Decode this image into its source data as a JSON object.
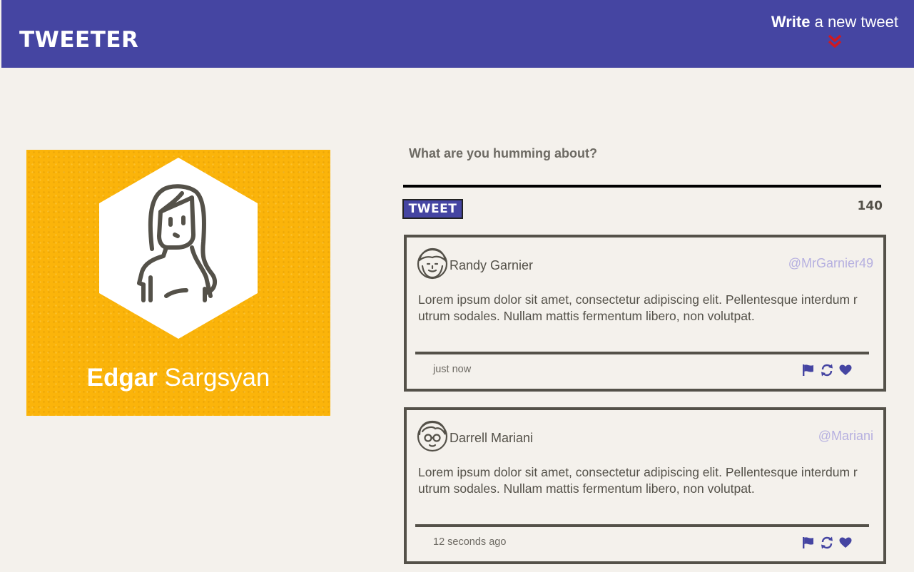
{
  "nav": {
    "brand": "TWEETER",
    "compose_bold": "Write",
    "compose_rest": "a new tweet",
    "toggle_icon": "double-chevron-down-icon",
    "accent": "#d2181f"
  },
  "profile": {
    "first_name": "Edgar",
    "last_name": "Sargsyan",
    "avatar_icon": "woman-avatar-icon"
  },
  "composer": {
    "placeholder": "What are you humming about?",
    "button_label": "TWEET",
    "counter": "140"
  },
  "tweets": [
    {
      "author": "Randy Garnier",
      "handle": "@MrGarnier49",
      "body": "Lorem ipsum dolor sit amet, consectetur adipiscing elit. Pellentesque interdum rutrum sodales. Nullam mattis fermentum libero, non volutpat.",
      "time": "just now",
      "avatar_icon": "bearded-man-avatar-icon"
    },
    {
      "author": "Darrell Mariani",
      "handle": "@Mariani",
      "body": "Lorem ipsum dolor sit amet, consectetur adipiscing elit. Pellentesque interdum rutrum sodales. Nullam mattis fermentum libero, non volutpat.",
      "time": "12 seconds ago",
      "avatar_icon": "glasses-man-avatar-icon"
    }
  ],
  "colors": {
    "nav_bg": "#4545a2",
    "page_bg": "#f4f1ec",
    "profile_bg": "#fbb40a",
    "handle": "#b6b0e0",
    "icon": "#4545a2"
  }
}
